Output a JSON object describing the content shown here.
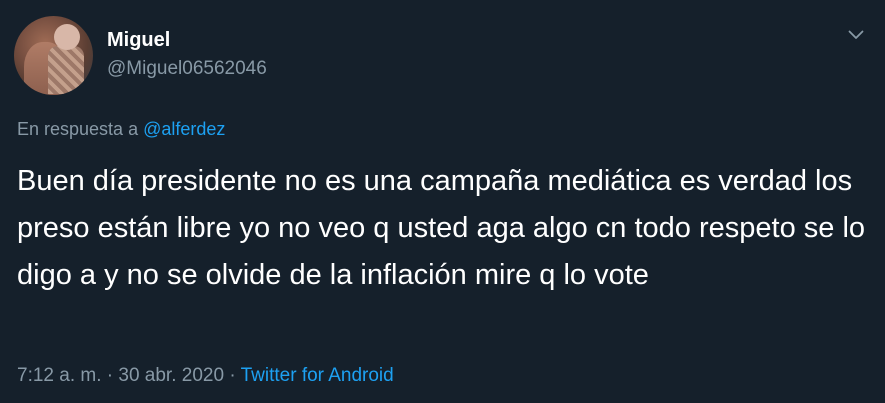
{
  "user": {
    "name": "Miguel",
    "handle": "@Miguel06562046"
  },
  "reply": {
    "prefix": "En respuesta a",
    "mention": "@alferdez"
  },
  "tweet": {
    "text": "Buen día presidente no es una campaña mediática es verdad los preso están libre yo no veo q usted aga algo cn todo respeto se lo digo a y no se olvide de la inflación mire q lo vote"
  },
  "meta": {
    "time": "7:12 a. m.",
    "separator1": " · ",
    "date": "30 abr. 2020",
    "separator2": " · ",
    "source": "Twitter for Android"
  },
  "icons": {
    "menu": "chevron-down-icon"
  },
  "colors": {
    "background": "#15202b",
    "text": "#ffffff",
    "secondary": "#8899a6",
    "accent": "#1da1f2"
  }
}
